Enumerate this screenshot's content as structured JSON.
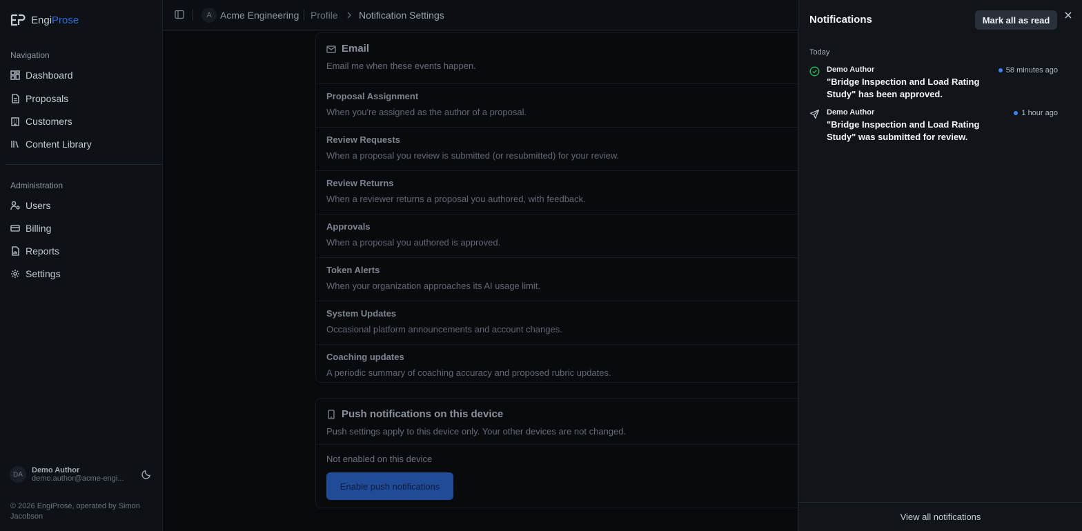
{
  "brand": {
    "name_part1": "Engi",
    "name_part2": "Prose",
    "accent_color": "#2f6ad8"
  },
  "sidebar": {
    "sections": [
      {
        "title": "Navigation",
        "items": [
          {
            "label": "Dashboard",
            "icon": "layout-grid-icon"
          },
          {
            "label": "Proposals",
            "icon": "file-text-icon"
          },
          {
            "label": "Customers",
            "icon": "building-icon"
          },
          {
            "label": "Content Library",
            "icon": "library-icon"
          }
        ]
      },
      {
        "title": "Administration",
        "items": [
          {
            "label": "Users",
            "icon": "user-cog-icon"
          },
          {
            "label": "Billing",
            "icon": "credit-card-icon"
          },
          {
            "label": "Reports",
            "icon": "file-chart-icon"
          },
          {
            "label": "Settings",
            "icon": "gear-icon"
          }
        ]
      }
    ],
    "user": {
      "initials": "DA",
      "name": "Demo Author",
      "email": "demo.author@acme-engi..."
    },
    "footer": "© 2026 EngiProse, operated by Simon Jacobson"
  },
  "header": {
    "org_initial": "A",
    "org_name": "Acme Engineering",
    "breadcrumb": [
      "Profile",
      "Notification Settings"
    ]
  },
  "email_card": {
    "title": "Email",
    "description": "Email me when these events happen.",
    "rows": [
      {
        "title": "Proposal Assignment",
        "description": "When you're assigned as the author of a proposal."
      },
      {
        "title": "Review Requests",
        "description": "When a proposal you review is submitted (or resubmitted) for your review."
      },
      {
        "title": "Review Returns",
        "description": "When a reviewer returns a proposal you authored, with feedback."
      },
      {
        "title": "Approvals",
        "description": "When a proposal you authored is approved."
      },
      {
        "title": "Token Alerts",
        "description": "When your organization approaches its AI usage limit."
      },
      {
        "title": "System Updates",
        "description": "Occasional platform announcements and account changes."
      },
      {
        "title": "Coaching updates",
        "description": "A periodic summary of coaching accuracy and proposed rubric updates."
      }
    ]
  },
  "push_card": {
    "title": "Push notifications on this device",
    "description": "Push settings apply to this device only. Your other devices are not changed.",
    "status": "Not enabled on this device",
    "button_label": "Enable push notifications"
  },
  "notifications": {
    "title": "Notifications",
    "mark_all_label": "Mark all as read",
    "group_label": "Today",
    "items": [
      {
        "author": "Demo Author",
        "message": "\"Bridge Inspection and Load Rating Study\" has been approved.",
        "time": "58 minutes ago",
        "icon": "check-circle-icon",
        "unread": true
      },
      {
        "author": "Demo Author",
        "message": "\"Bridge Inspection and Load Rating Study\" was submitted for review.",
        "time": "1 hour ago",
        "icon": "send-icon",
        "unread": true
      }
    ],
    "view_all_label": "View all notifications"
  }
}
